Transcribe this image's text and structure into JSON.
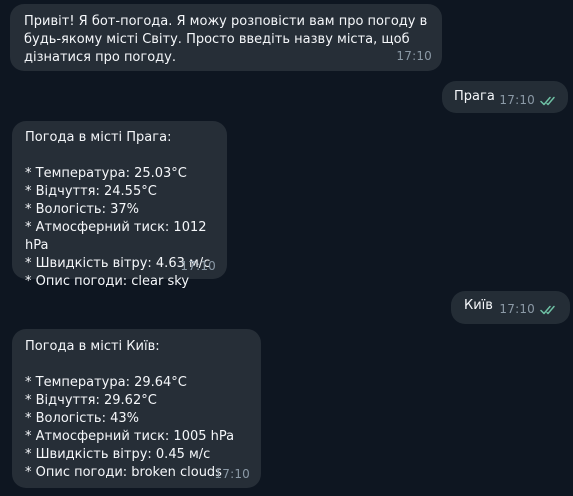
{
  "messages": [
    {
      "direction": "incoming",
      "text": "Привіт! Я бот-погода. Я можу розповісти вам про погоду в будь-якому місті Світу. Просто введіть назву міста, щоб дізнатися про погоду.",
      "time": "17:10"
    },
    {
      "direction": "outgoing",
      "text": "Прага",
      "time": "17:10",
      "status": "read"
    },
    {
      "direction": "incoming",
      "text": "Погода в місті Прага:\n\n* Температура: 25.03°C\n* Відчуття: 24.55°C\n* Вологість: 37%\n* Атмосферний тиск: 1012 hPa\n* Швидкість вітру: 4.63 м/с\n* Опис погоди: clear sky",
      "time": "17:10"
    },
    {
      "direction": "outgoing",
      "text": "Київ",
      "time": "17:10",
      "status": "read"
    },
    {
      "direction": "incoming",
      "text": "Погода в місті Київ:\n\n* Температура: 29.64°C\n* Відчуття: 29.62°C\n* Вологість: 43%\n* Атмосферний тиск: 1005 hPa\n* Швидкість вітру: 0.45 м/с\n* Опис погоди: broken clouds",
      "time": "17:10"
    }
  ],
  "colors": {
    "background": "#0e1621",
    "incoming_bubble": "#262e37",
    "outgoing_bubble": "#242d36",
    "text": "#f5f7fa",
    "time": "#8b99a6",
    "read_ticks": "#6ec0a4"
  },
  "icons": {
    "read_status": "double-check-icon"
  }
}
